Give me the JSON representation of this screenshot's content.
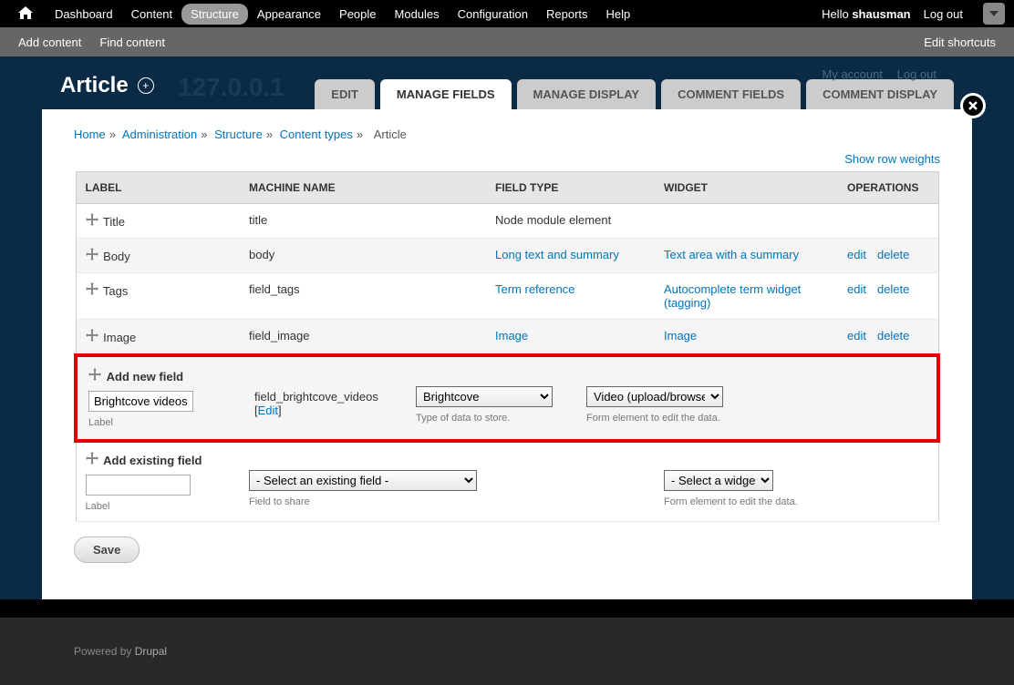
{
  "toolbar": {
    "items": [
      "Dashboard",
      "Content",
      "Structure",
      "Appearance",
      "People",
      "Modules",
      "Configuration",
      "Reports",
      "Help"
    ],
    "active_index": 2,
    "hello": "Hello ",
    "username": "shausman",
    "logout": "Log out"
  },
  "shortcuts": {
    "add": "Add content",
    "find": "Find content",
    "edit": "Edit shortcuts"
  },
  "user_links": {
    "account": "My account",
    "logout": "Log out"
  },
  "ghost_ip": "127.0.0.1",
  "page": {
    "title": "Article",
    "tabs": [
      "EDIT",
      "MANAGE FIELDS",
      "MANAGE DISPLAY",
      "COMMENT FIELDS",
      "COMMENT DISPLAY"
    ],
    "active_tab": 1
  },
  "breadcrumb": {
    "home": "Home",
    "admin": "Administration",
    "structure": "Structure",
    "content_types": "Content types",
    "article": "Article"
  },
  "table": {
    "show_weights": "Show row weights",
    "headers": {
      "label": "LABEL",
      "machine": "MACHINE NAME",
      "type": "FIELD TYPE",
      "widget": "WIDGET",
      "ops": "OPERATIONS"
    },
    "rows": [
      {
        "label": "Title",
        "machine": "title",
        "type": "Node module element",
        "type_link": false,
        "widget": "",
        "edit": false,
        "delete": false
      },
      {
        "label": "Body",
        "machine": "body",
        "type": "Long text and summary",
        "type_link": true,
        "widget": "Text area with a summary",
        "edit": true,
        "delete": true
      },
      {
        "label": "Tags",
        "machine": "field_tags",
        "type": "Term reference",
        "type_link": true,
        "widget": "Autocomplete term widget (tagging)",
        "edit": true,
        "delete": true
      },
      {
        "label": "Image",
        "machine": "field_image",
        "type": "Image",
        "type_link": true,
        "widget": "Image",
        "edit": true,
        "delete": true
      }
    ],
    "ops": {
      "edit": "edit",
      "delete": "delete"
    },
    "add_new": {
      "header": "Add new field",
      "label_value": "Brightcove videos",
      "label_help": "Label",
      "machine": "field_brightcove_videos",
      "edit_link": "Edit",
      "type_value": "Brightcove",
      "type_help": "Type of data to store.",
      "widget_value": "Video (upload/browse)",
      "widget_help": "Form element to edit the data."
    },
    "add_existing": {
      "header": "Add existing field",
      "label_value": "",
      "label_help": "Label",
      "field_value": "- Select an existing field -",
      "field_help": "Field to share",
      "widget_value": "- Select a widget -",
      "widget_help": "Form element to edit the data."
    }
  },
  "save": "Save",
  "footer": {
    "powered": "Powered by ",
    "drupal": "Drupal"
  }
}
